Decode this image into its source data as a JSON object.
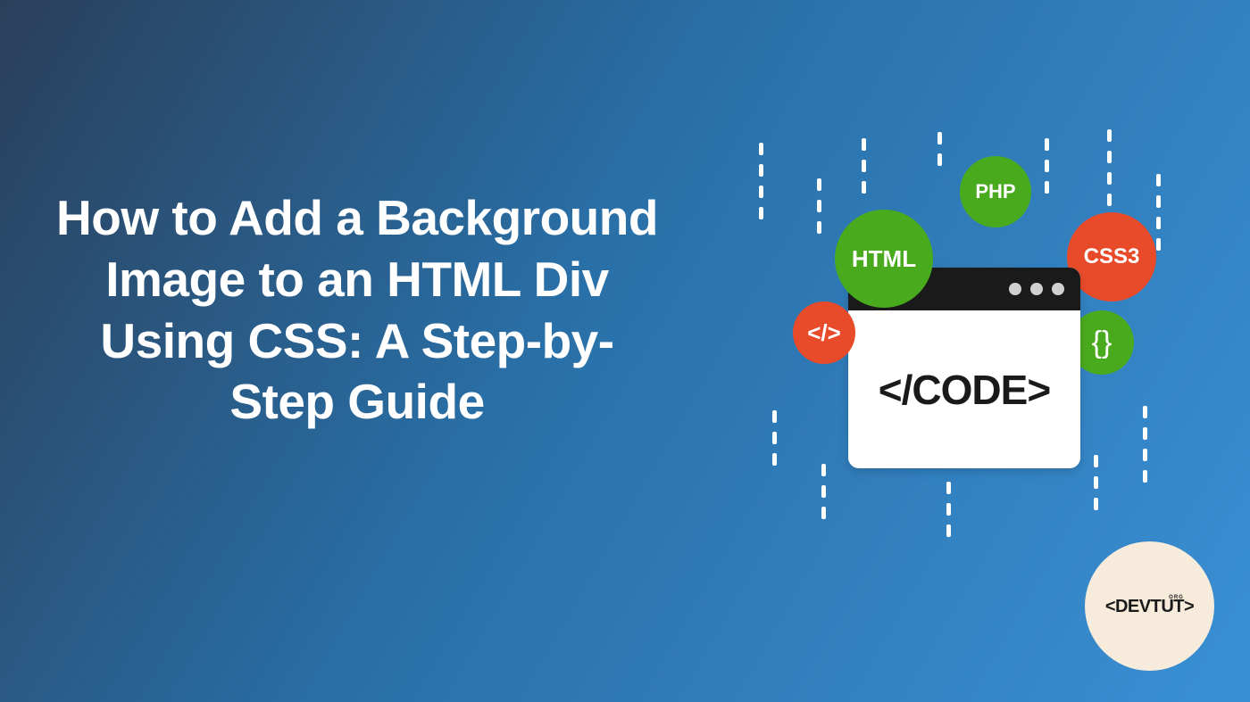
{
  "title": "How to Add a Background Image to an HTML Div Using CSS: A Step-by-Step Guide",
  "bubbles": {
    "html": "HTML",
    "php": "PHP",
    "css3": "CSS3",
    "tag": "</>",
    "brace": "{}"
  },
  "browser": {
    "code_text": "</CODE>"
  },
  "logo": {
    "main": "<DEVTUT>",
    "sub": "ORG"
  }
}
